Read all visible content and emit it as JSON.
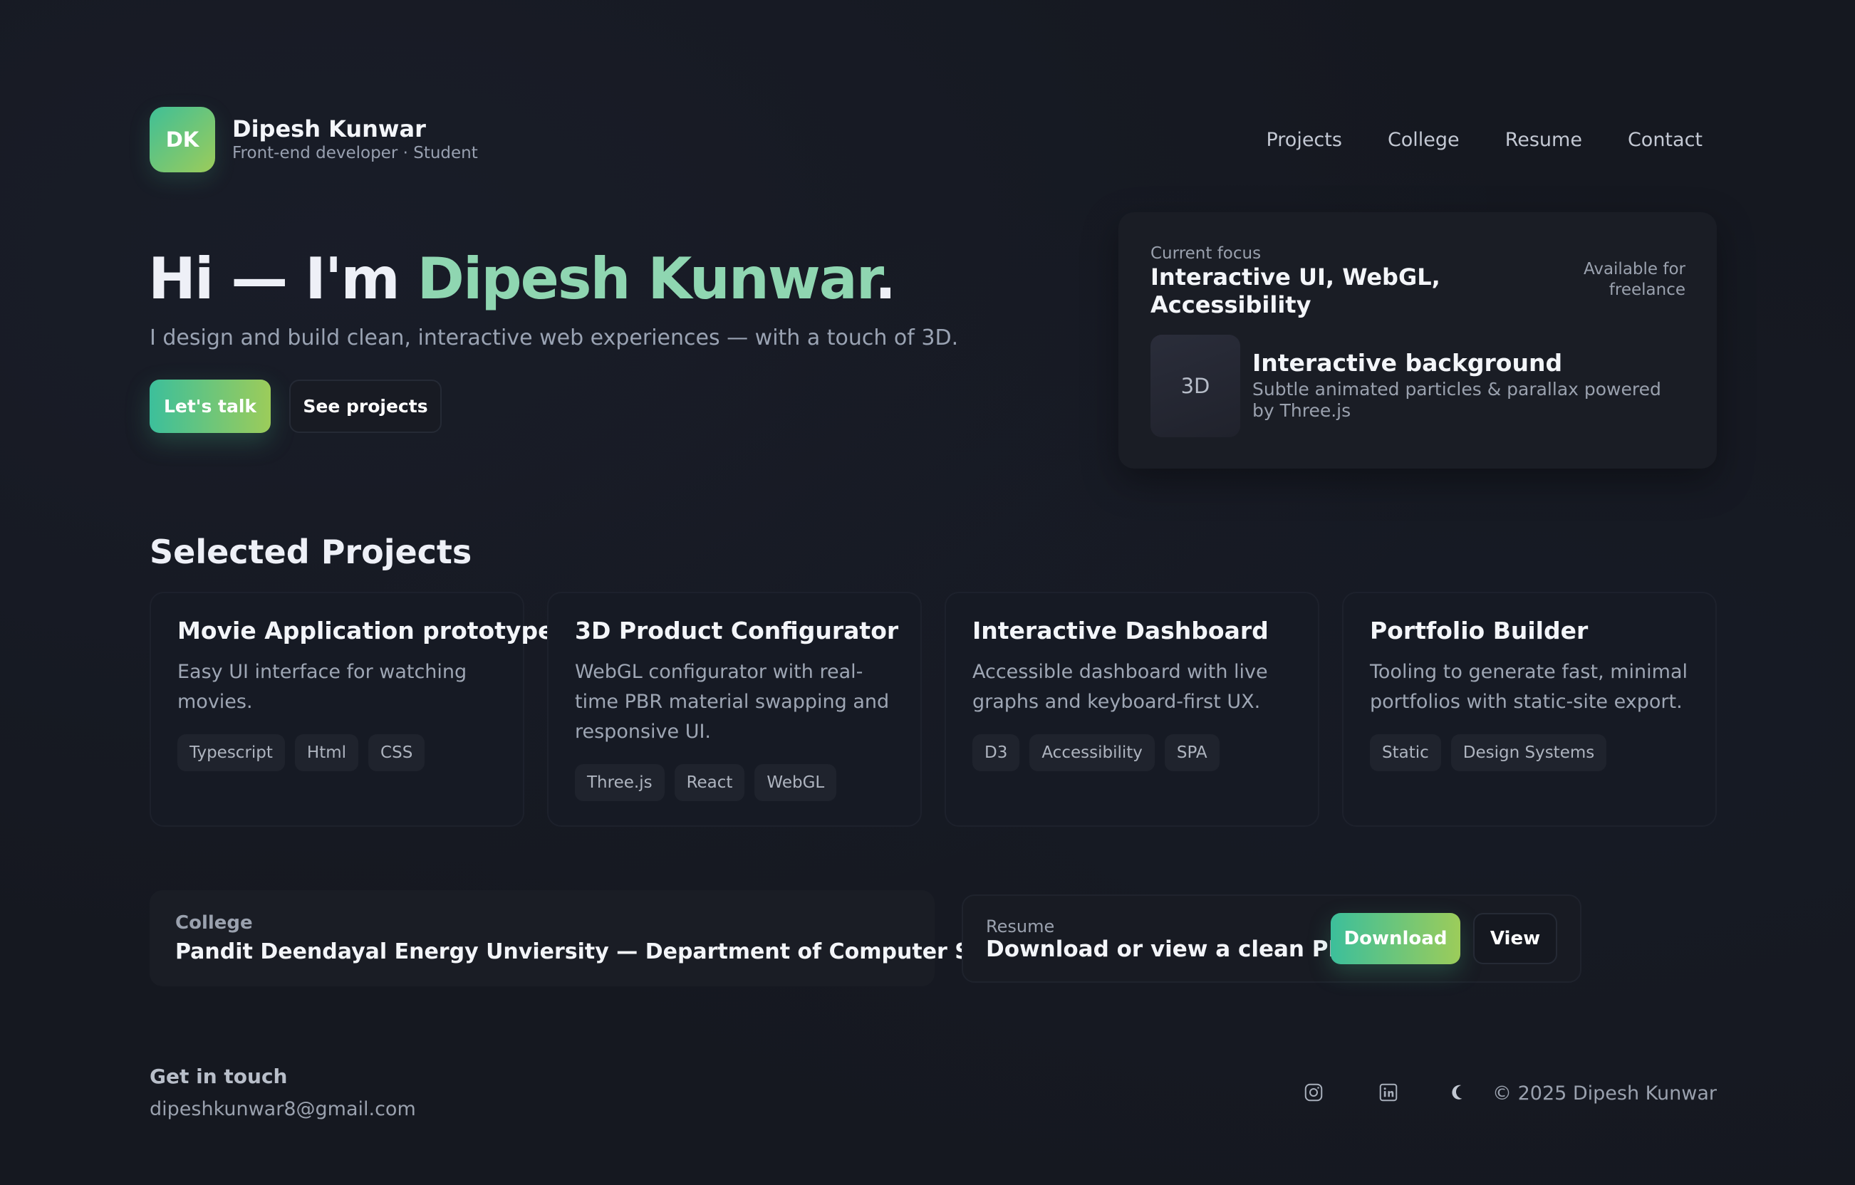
{
  "brand": {
    "initials": "DK",
    "name": "Dipesh Kunwar",
    "tagline": "Front-end developer · Student"
  },
  "nav": {
    "items": [
      {
        "label": "Projects"
      },
      {
        "label": "College"
      },
      {
        "label": "Resume"
      },
      {
        "label": "Contact"
      }
    ]
  },
  "hero": {
    "greeting": "Hi — I'm ",
    "name": "Dipesh Kunwar",
    "period": ".",
    "subtitle": "I design and build clean, interactive web experiences — with a touch of 3D.",
    "primary_cta": "Let's talk",
    "secondary_cta": "See projects"
  },
  "focus": {
    "label": "Current focus",
    "title": "Interactive UI, WebGL, Accessibility",
    "availability": "Available for freelance",
    "badge": "3D",
    "feature_title": "Interactive background",
    "feature_desc": "Subtle animated particles & parallax powered by Three.js"
  },
  "projects": {
    "heading": "Selected Projects",
    "items": [
      {
        "title": "Movie Application prototype",
        "desc": "Easy UI interface for watching movies.",
        "tags": [
          "Typescript",
          "Html",
          "CSS"
        ]
      },
      {
        "title": "3D Product Configurator",
        "desc": "WebGL configurator with real-time PBR material swapping and responsive UI.",
        "tags": [
          "Three.js",
          "React",
          "WebGL"
        ]
      },
      {
        "title": "Interactive Dashboard",
        "desc": "Accessible dashboard with live graphs and keyboard-first UX.",
        "tags": [
          "D3",
          "Accessibility",
          "SPA"
        ]
      },
      {
        "title": "Portfolio Builder",
        "desc": "Tooling to generate fast, minimal portfolios with static-site export.",
        "tags": [
          "Static",
          "Design Systems"
        ]
      }
    ]
  },
  "college": {
    "label": "College",
    "name": "Pandit Deendayal Energy Unviersity — Department of Computer Science"
  },
  "resume": {
    "label": "Resume",
    "title": "Download or view a clean PDF",
    "download": "Download",
    "view": "View"
  },
  "footer": {
    "label": "Get in touch",
    "email": "dipeshkunwar8@gmail.com",
    "socials": [
      "instagram-icon",
      "linkedin-icon",
      "moon-icon"
    ],
    "copyright": "© 2025 Dipesh Kunwar"
  },
  "colors": {
    "background": "#151820",
    "accent_green": "#3cbf9b",
    "accent_lime": "#9ccc5a",
    "name_highlight": "#8fd6b1"
  }
}
